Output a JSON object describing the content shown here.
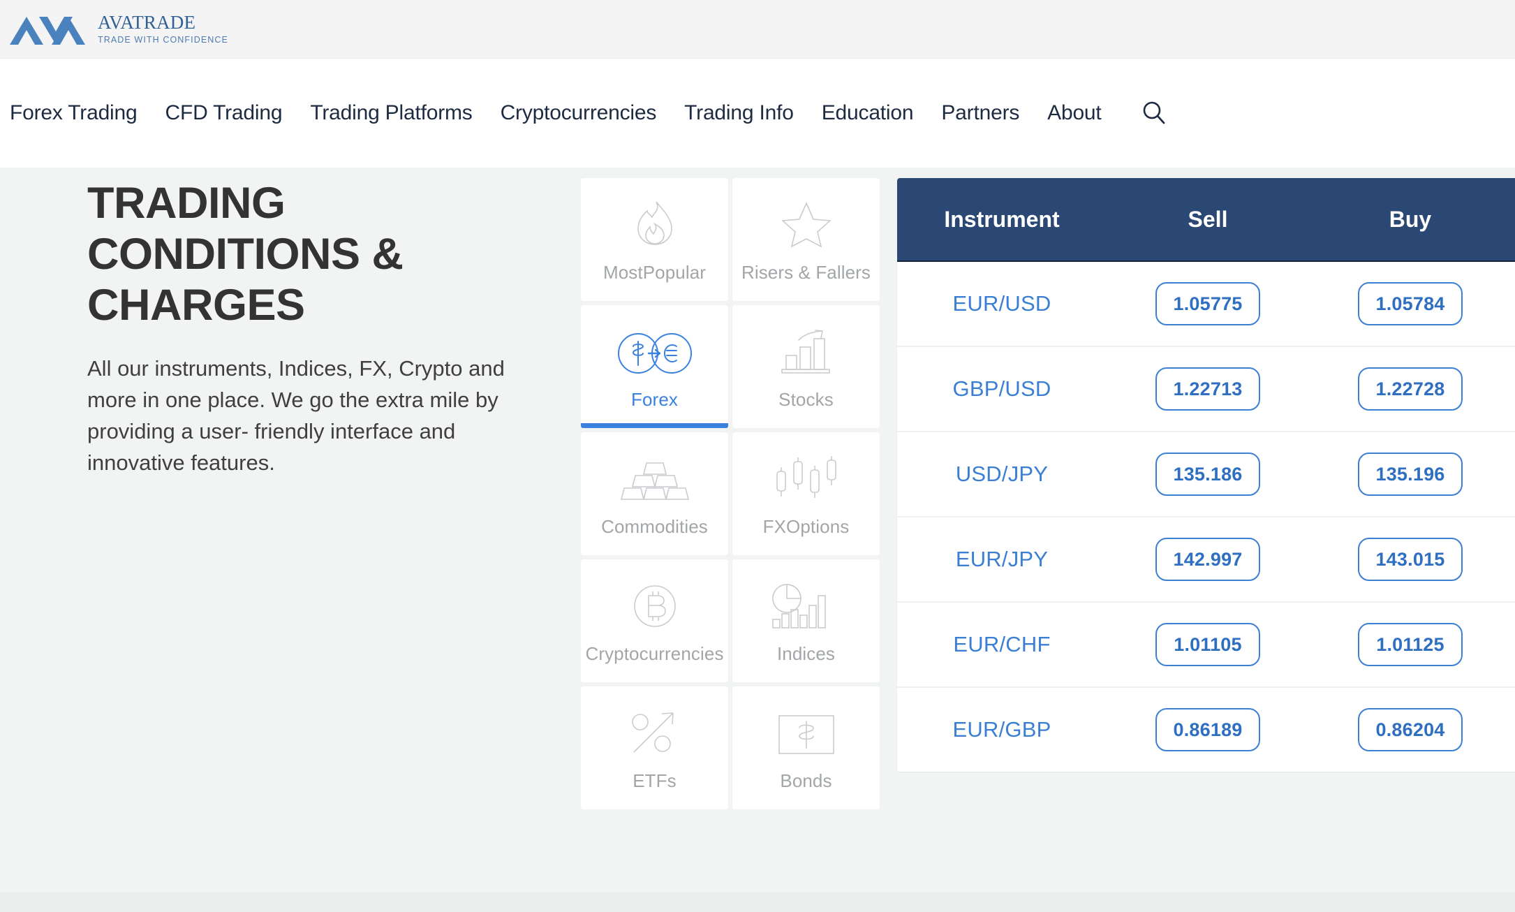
{
  "brand": {
    "logo_icon": "ava-chevron-logo",
    "name": "AVATRADE",
    "tagline": "TRADE WITH CONFIDENCE",
    "logo_color": "#4a82bd",
    "name_color": "#2f6096"
  },
  "nav": {
    "items": [
      {
        "label": "Forex Trading",
        "name": "nav-item-forex-trading"
      },
      {
        "label": "CFD Trading",
        "name": "nav-item-cfd-trading"
      },
      {
        "label": "Trading Platforms",
        "name": "nav-item-trading-platforms"
      },
      {
        "label": "Cryptocurrencies",
        "name": "nav-item-cryptocurrencies"
      },
      {
        "label": "Trading Info",
        "name": "nav-item-trading-info"
      },
      {
        "label": "Education",
        "name": "nav-item-education"
      },
      {
        "label": "Partners",
        "name": "nav-item-partners"
      },
      {
        "label": "About",
        "name": "nav-item-about"
      }
    ],
    "search_icon": "search-icon",
    "text_color": "#1d2b41"
  },
  "hero": {
    "headline": "Trading Conditions & Charges",
    "paragraph": "All our instruments, Indices, FX, Crypto and more in one place. We go the extra mile by providing a user- friendly interface and innovative features.",
    "headline_color": "#333333"
  },
  "categories": {
    "active": "Forex",
    "active_color": "#3b82e0",
    "inactive_color": "#a2a6a9",
    "items": [
      {
        "label": "MostPopular",
        "icon": "flame-icon",
        "active": false
      },
      {
        "label": "Risers & Fallers",
        "icon": "star-icon",
        "active": false
      },
      {
        "label": "Forex",
        "icon": "currency-exchange-icon",
        "active": true
      },
      {
        "label": "Stocks",
        "icon": "bar-chart-arrow-icon",
        "active": false
      },
      {
        "label": "Commodities",
        "icon": "gold-bars-icon",
        "active": false
      },
      {
        "label": "FXOptions",
        "icon": "candlestick-icon",
        "active": false
      },
      {
        "label": "Cryptocurrencies",
        "icon": "bitcoin-icon",
        "active": false
      },
      {
        "label": "Indices",
        "icon": "pie-bar-chart-icon",
        "active": false
      },
      {
        "label": "ETFs",
        "icon": "percent-arrow-icon",
        "active": false
      },
      {
        "label": "Bonds",
        "icon": "banknote-dollar-icon",
        "active": false
      }
    ]
  },
  "quotes": {
    "header_bg": "#2a4873",
    "accent": "#3b7fd4",
    "columns": [
      "Instrument",
      "Sell",
      "Buy"
    ],
    "rows": [
      {
        "instrument": "EUR/USD",
        "sell": "1.05775",
        "buy": "1.05784"
      },
      {
        "instrument": "GBP/USD",
        "sell": "1.22713",
        "buy": "1.22728"
      },
      {
        "instrument": "USD/JPY",
        "sell": "135.186",
        "buy": "135.196"
      },
      {
        "instrument": "EUR/JPY",
        "sell": "142.997",
        "buy": "143.015"
      },
      {
        "instrument": "EUR/CHF",
        "sell": "1.01105",
        "buy": "1.01125"
      },
      {
        "instrument": "EUR/GBP",
        "sell": "0.86189",
        "buy": "0.86204"
      }
    ]
  }
}
